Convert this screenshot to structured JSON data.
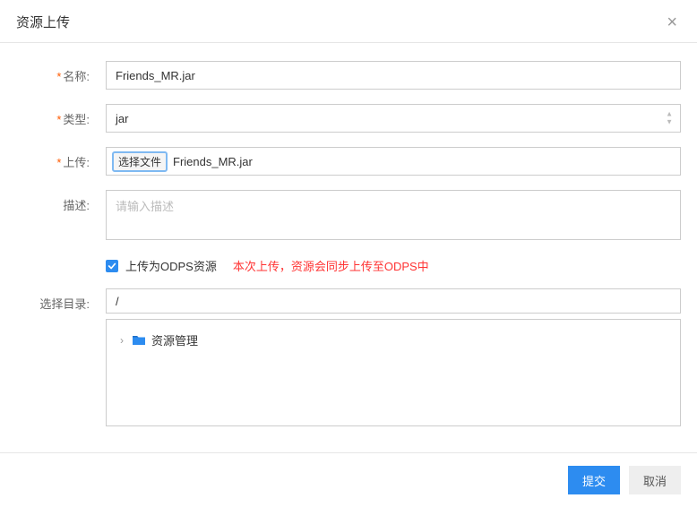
{
  "modal": {
    "title": "资源上传",
    "close": "×"
  },
  "form": {
    "name": {
      "label": "名称:",
      "value": "Friends_MR.jar",
      "required": true
    },
    "type": {
      "label": "类型:",
      "value": "jar",
      "required": true
    },
    "upload": {
      "label": "上传:",
      "button": "选择文件",
      "filename": "Friends_MR.jar",
      "required": true
    },
    "description": {
      "label": "描述:",
      "placeholder": "请输入描述",
      "value": "",
      "required": false
    },
    "odps": {
      "label": "上传为ODPS资源",
      "warning": "本次上传，资源会同步上传至ODPS中",
      "checked": true
    },
    "directory": {
      "label": "选择目录:",
      "path": "/",
      "tree": {
        "root": "资源管理"
      }
    }
  },
  "footer": {
    "submit": "提交",
    "cancel": "取消"
  }
}
